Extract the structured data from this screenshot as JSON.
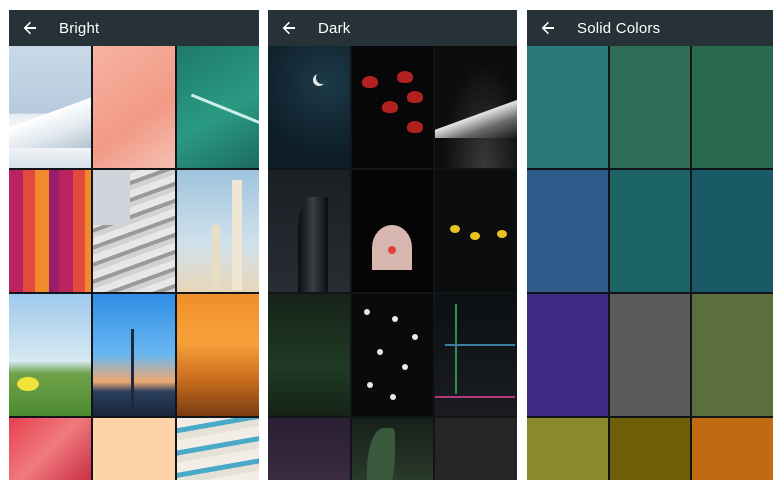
{
  "panels": [
    {
      "title": "Bright"
    },
    {
      "title": "Dark"
    },
    {
      "title": "Solid Colors"
    }
  ],
  "solid_colors": [
    "#2a7a7a",
    "#2e6e56",
    "#2a6a4e",
    "#2f5a8c",
    "#1c6466",
    "#1a5a66",
    "#3d2b86",
    "#5a5a5a",
    "#5a6e3e",
    "#8a8a2a",
    "#6e5e08",
    "#c26a12"
  ],
  "icons": {
    "back": "arrow-left-icon"
  }
}
